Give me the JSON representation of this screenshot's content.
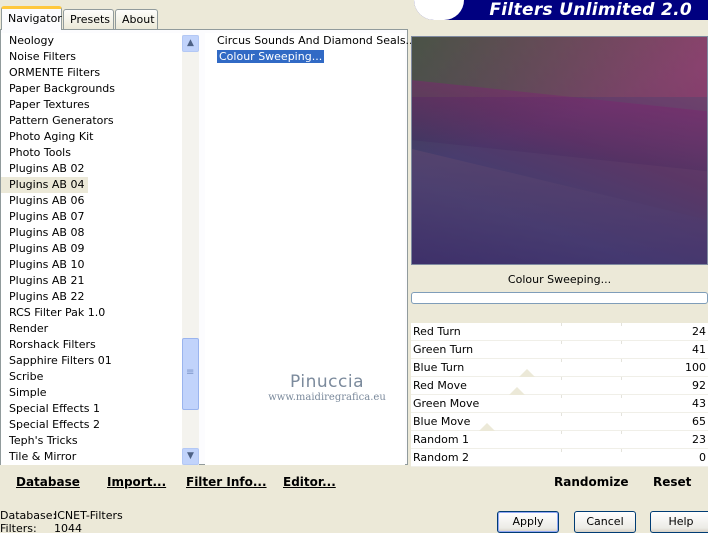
{
  "tabs": [
    {
      "label": "Navigator",
      "active": true
    },
    {
      "label": "Presets",
      "active": false
    },
    {
      "label": "About",
      "active": false
    }
  ],
  "app_title": "Filters Unlimited 2.0",
  "categories": [
    "Neology",
    "Noise Filters",
    "ORMENTE Filters",
    "Paper Backgrounds",
    "Paper Textures",
    "Pattern Generators",
    "Photo Aging Kit",
    "Photo Tools",
    "Plugins AB 02",
    "Plugins AB 04",
    "Plugins AB 06",
    "Plugins AB 07",
    "Plugins AB 08",
    "Plugins AB 09",
    "Plugins AB 10",
    "Plugins AB 21",
    "Plugins AB 22",
    "RCS Filter Pak 1.0",
    "Render",
    "Rorshack Filters",
    "Sapphire Filters 01",
    "Scribe",
    "Simple",
    "Special Effects 1",
    "Special Effects 2",
    "Teph's Tricks",
    "Tile & Mirror"
  ],
  "selected_category": "Plugins AB 04",
  "filters": [
    "Circus Sounds And Diamond Seals...",
    "Colour Sweeping..."
  ],
  "selected_filter": "Colour Sweeping...",
  "watermark": {
    "line1": "Pinuccia",
    "line2": "www.maidiregrafica.eu"
  },
  "bottom_links": {
    "database": "Database",
    "import": "Import...",
    "filter_info": "Filter Info...",
    "editor": "Editor..."
  },
  "preview_filter_name": "Colour Sweeping...",
  "params": [
    {
      "label": "Red Turn",
      "value": "24"
    },
    {
      "label": "Green Turn",
      "value": "41"
    },
    {
      "label": "Blue Turn",
      "value": "100"
    },
    {
      "label": "Red Move",
      "value": "92"
    },
    {
      "label": "Green Move",
      "value": "43"
    },
    {
      "label": "Blue Move",
      "value": "65"
    },
    {
      "label": "Random 1",
      "value": "23"
    },
    {
      "label": "Random 2",
      "value": "0"
    }
  ],
  "right_links": {
    "randomize": "Randomize",
    "reset": "Reset"
  },
  "status": {
    "database_label": "Database:",
    "database_value": "ICNET-Filters",
    "filters_label": "Filters:",
    "filters_value": "1044"
  },
  "buttons": {
    "apply": "Apply",
    "cancel": "Cancel",
    "help": "Help"
  }
}
